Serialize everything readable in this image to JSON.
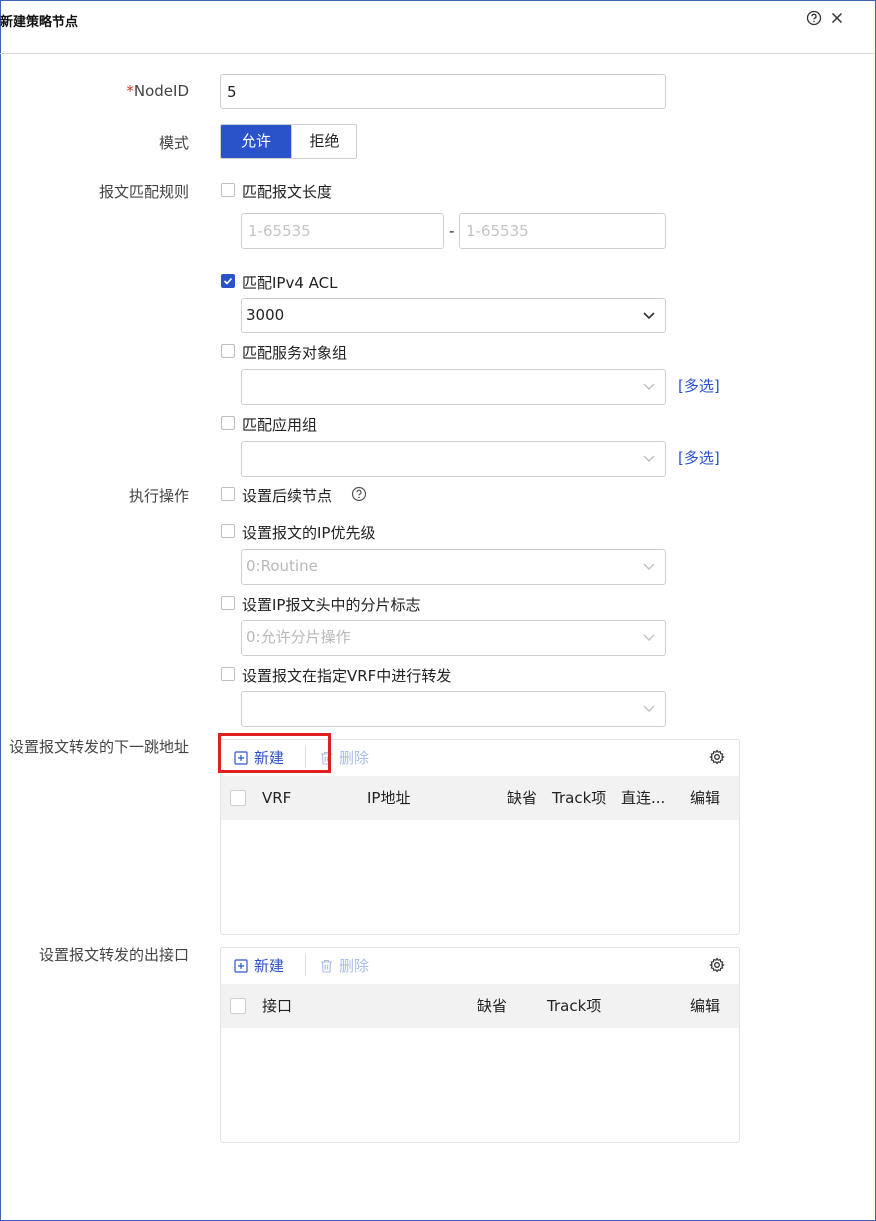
{
  "dialog": {
    "title": "新建策略节点"
  },
  "form": {
    "node_id": {
      "required_mark": "*",
      "label": "NodeID",
      "value": "5"
    },
    "mode": {
      "label": "模式",
      "options": [
        "允许",
        "拒绝"
      ],
      "selected": "允许"
    },
    "match_rules": {
      "label": "报文匹配规则",
      "length": {
        "label": "匹配报文长度",
        "checked": false,
        "min_placeholder": "1-65535",
        "separator": "-",
        "max_placeholder": "1-65535"
      },
      "ipv4_acl": {
        "label": "匹配IPv4 ACL",
        "checked": true,
        "value": "3000"
      },
      "service_group": {
        "label": "匹配服务对象组",
        "checked": false,
        "value": "",
        "multi_link": "[多选]"
      },
      "app_group": {
        "label": "匹配应用组",
        "checked": false,
        "value": "",
        "multi_link": "[多选]"
      }
    },
    "actions": {
      "label": "执行操作",
      "next_node": {
        "label": "设置后续节点",
        "checked": false
      },
      "ip_precedence": {
        "label": "设置报文的IP优先级",
        "checked": false,
        "value": "0:Routine"
      },
      "fragment_flag": {
        "label": "设置IP报文头中的分片标志",
        "checked": false,
        "value": "0:允许分片操作"
      },
      "vrf_forward": {
        "label": "设置报文在指定VRF中进行转发",
        "checked": false,
        "value": ""
      }
    },
    "next_hop": {
      "label": "设置报文转发的下一跳地址",
      "new_label": "新建",
      "delete_label": "删除",
      "columns": [
        "VRF",
        "IP地址",
        "缺省",
        "Track项",
        "直连...",
        "编辑"
      ]
    },
    "out_interface": {
      "label": "设置报文转发的出接口",
      "new_label": "新建",
      "delete_label": "删除",
      "columns": [
        "接口",
        "缺省",
        "Track项",
        "编辑"
      ]
    }
  },
  "colors": {
    "accent": "#2b53c9",
    "highlight": "#e02020"
  }
}
